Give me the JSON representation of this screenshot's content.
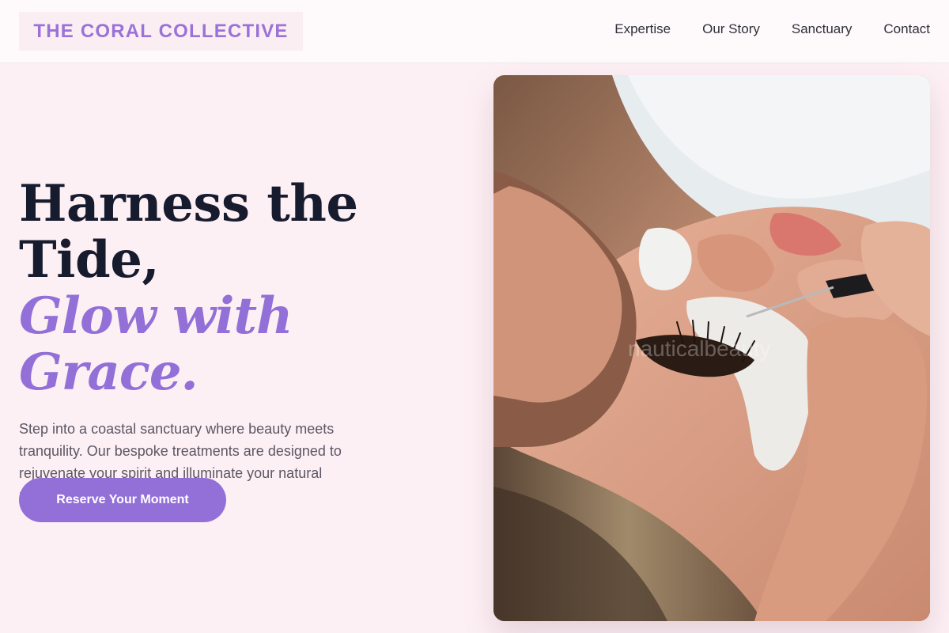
{
  "brand": {
    "name": "THE CORAL COLLECTIVE"
  },
  "nav": {
    "items": [
      {
        "label": "Expertise"
      },
      {
        "label": "Our Story"
      },
      {
        "label": "Sanctuary"
      },
      {
        "label": "Contact"
      }
    ]
  },
  "hero": {
    "headline_line1": "Harness the",
    "headline_line2": "Tide,",
    "headline_accent": "Glow with Grace.",
    "description": "Step into a coastal sanctuary where beauty meets tranquility. Our bespoke treatments are designed to rejuvenate your spirit and illuminate your natural radiance.",
    "cta_label": "Reserve Your Moment",
    "image_watermark": "nauticalbeauty"
  },
  "colors": {
    "accent": "#9370d8",
    "page_background": "#fdf0f4",
    "heading": "#171b2e",
    "body_text": "#5b5763"
  }
}
